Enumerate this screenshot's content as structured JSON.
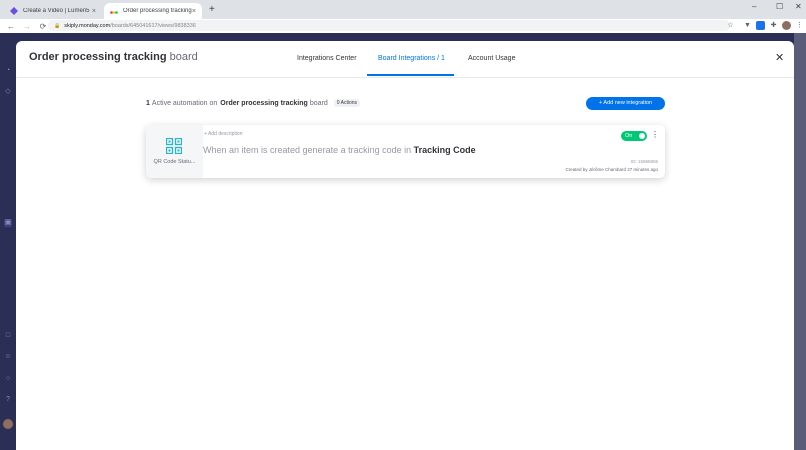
{
  "browser": {
    "tabs": [
      {
        "title": "Create a Video | Lumen5",
        "active": false
      },
      {
        "title": "Order processing tracking",
        "active": true
      }
    ],
    "url_host": "skiply.monday.com",
    "url_path": "/boards/645041617/views/9838336",
    "new_tab": "+",
    "tab_close": "×",
    "window_controls": [
      "–",
      "☐",
      "✕"
    ]
  },
  "modal": {
    "title_bold": "Order processing tracking",
    "title_light": "board",
    "tabs": [
      {
        "label": "Integrations Center",
        "active": false
      },
      {
        "label": "Board Integrations / 1",
        "active": true
      },
      {
        "label": "Account Usage",
        "active": false
      }
    ],
    "close": "✕"
  },
  "summary": {
    "count": "1",
    "text_1": "Active automation on",
    "board_name": "Order processing tracking",
    "text_2": "board",
    "actions_badge": "0 Actions",
    "add_button": "+ Add new integration"
  },
  "card": {
    "icon_label": "QR Code Statu...",
    "add_description": "+ Add description",
    "recipe_prefix": "When an item is created generate a tracking code in",
    "recipe_column": "Tracking Code",
    "toggle_label": "On",
    "menu": "⋮",
    "automation_id": "ID: 15965806",
    "created_by": "Created by Jérôme Chambard 27 minutes ago"
  },
  "colors": {
    "accent": "#0073ea",
    "toggle_on": "#00c875",
    "qr_icon": "#2ab5c4",
    "nav_bg": "#2b2e55"
  }
}
